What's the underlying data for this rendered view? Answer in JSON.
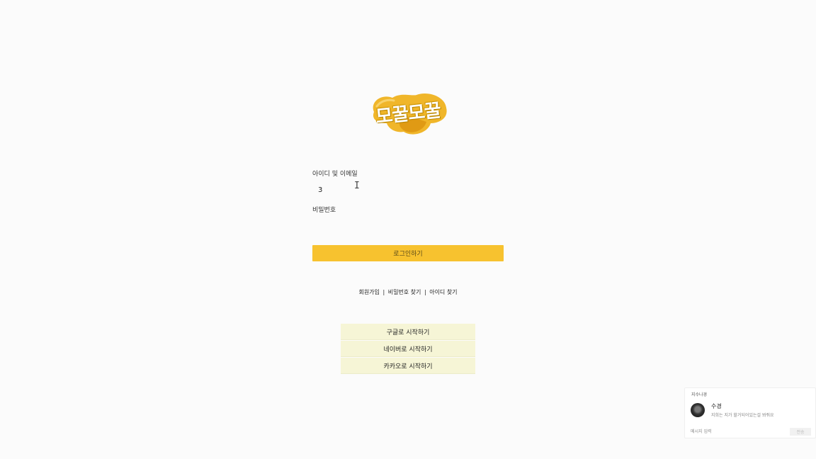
{
  "logo": {
    "text": "모꿀모꿀",
    "blob_color": "#f0b62a",
    "blob_dark_color": "#e09a14"
  },
  "login_form": {
    "id_label": "아이디 및 이메일",
    "id_value": "3",
    "password_label": "비밀번호",
    "password_value": "",
    "login_button_label": "로그인하기",
    "login_button_color": "#f7c22f"
  },
  "links": {
    "signup": "회원가입",
    "separator": "|",
    "find_password": "비밀번호 찾기",
    "find_id": "아이디 찾기"
  },
  "social_login": {
    "google_label": "구글로 시작하기",
    "naver_label": "네이버로 시작하기",
    "kakao_label": "카카오로 시작하기",
    "button_color": "#f6f5d6"
  },
  "chat_widget": {
    "header": "지수나경",
    "user_name": "수경",
    "message_preview": "지희는 지가 할거되어있는걸 봐줘요",
    "input_placeholder": "메시지 입력",
    "send_label": "전송"
  },
  "cursor_icon": "text-cursor-icon"
}
